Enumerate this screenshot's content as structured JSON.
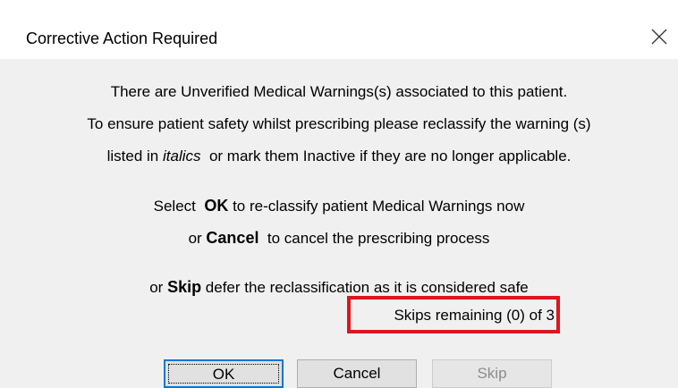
{
  "window": {
    "title": "Corrective Action Required",
    "close_icon": "close-icon"
  },
  "message": {
    "line1": "There are Unverified Medical Warnings(s) associated to this patient.",
    "line2": "To ensure patient safety whilst prescribing please reclassify the warning (s)",
    "line3_pre": "listed in ",
    "line3_italic": "italics",
    "line3_post": "  or mark them Inactive if they are no longer applicable.",
    "ok_pre": "Select  ",
    "ok_bold": "OK",
    "ok_post": " to re-classify patient Medical Warnings now",
    "cancel_pre": "or ",
    "cancel_bold": "Cancel",
    "cancel_post": "  to cancel the prescribing process",
    "skip_pre": "or ",
    "skip_bold": "Skip",
    "skip_post": " defer the reclassification as it is considered safe",
    "skips_remaining": "Skips remaining (0) of 3"
  },
  "buttons": {
    "ok": "OK",
    "cancel": "Cancel",
    "skip": "Skip"
  },
  "colors": {
    "highlight_box": "#e0141e",
    "focus_border": "#0078d7"
  }
}
